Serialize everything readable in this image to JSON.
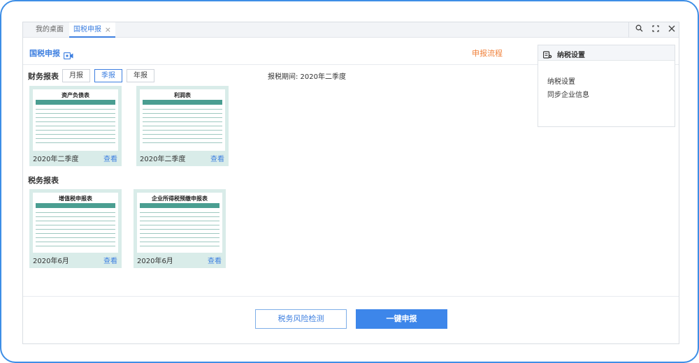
{
  "tabs": [
    {
      "label": "我的桌面"
    },
    {
      "label": "国税申报",
      "close": "×"
    }
  ],
  "window_controls": {
    "search": "search-icon",
    "maximize": "maximize-icon",
    "close": "close-icon"
  },
  "header": {
    "title": "国税申报",
    "flow_link": "申报流程",
    "video_icon": "video-camera-icon"
  },
  "financial": {
    "section_title": "财务报表",
    "periods": [
      {
        "label": "月报"
      },
      {
        "label": "季报",
        "active": true
      },
      {
        "label": "年报"
      }
    ],
    "tax_period": "报税期间: 2020年二季度",
    "cards": [
      {
        "title": "资产负债表",
        "caption": "2020年二季度",
        "view": "查看"
      },
      {
        "title": "利润表",
        "caption": "2020年二季度",
        "view": "查看"
      }
    ]
  },
  "tax": {
    "section_title": "税务报表",
    "cards": [
      {
        "title": "增值税申报表",
        "caption": "2020年6月",
        "view": "查看"
      },
      {
        "title": "企业所得税预缴申报表",
        "caption": "2020年6月",
        "view": "查看"
      }
    ]
  },
  "settings_panel": {
    "title": "纳税设置",
    "items": [
      {
        "label": "纳税设置"
      },
      {
        "label": "同步企业信息"
      }
    ]
  },
  "footer": {
    "risk_button": "税务风险检测",
    "submit_button": "一键申报"
  },
  "colors": {
    "accent": "#3d7fe0",
    "orange": "#f0823c",
    "card_bg": "#d9ece9",
    "table_header": "#4a9e91"
  }
}
